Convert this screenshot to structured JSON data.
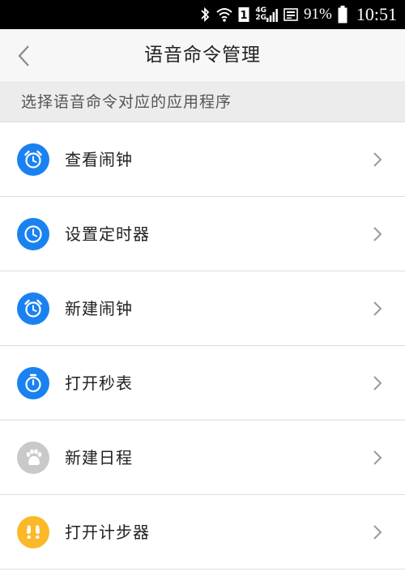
{
  "status_bar": {
    "bluetooth_icon": "bluetooth-icon",
    "wifi_icon": "wifi-icon",
    "sim_label": "1",
    "net_top": "4G",
    "net_bottom": "2G",
    "battery_percent": "91%",
    "time": "10:51"
  },
  "nav": {
    "title": "语音命令管理",
    "back_icon": "chevron-left-icon"
  },
  "section_header": "选择语音命令对应的应用程序",
  "items": [
    {
      "label": "查看闹钟",
      "icon": "alarm-clock-icon",
      "color": "#1a82f0"
    },
    {
      "label": "设置定时器",
      "icon": "clock-icon",
      "color": "#1a82f0"
    },
    {
      "label": "新建闹钟",
      "icon": "alarm-clock-icon",
      "color": "#1a82f0"
    },
    {
      "label": "打开秒表",
      "icon": "stopwatch-icon",
      "color": "#1a82f0"
    },
    {
      "label": "新建日程",
      "icon": "paw-icon",
      "color": "#c9c9c9"
    },
    {
      "label": "打开计步器",
      "icon": "footprints-icon",
      "color": "#fbb829"
    }
  ]
}
